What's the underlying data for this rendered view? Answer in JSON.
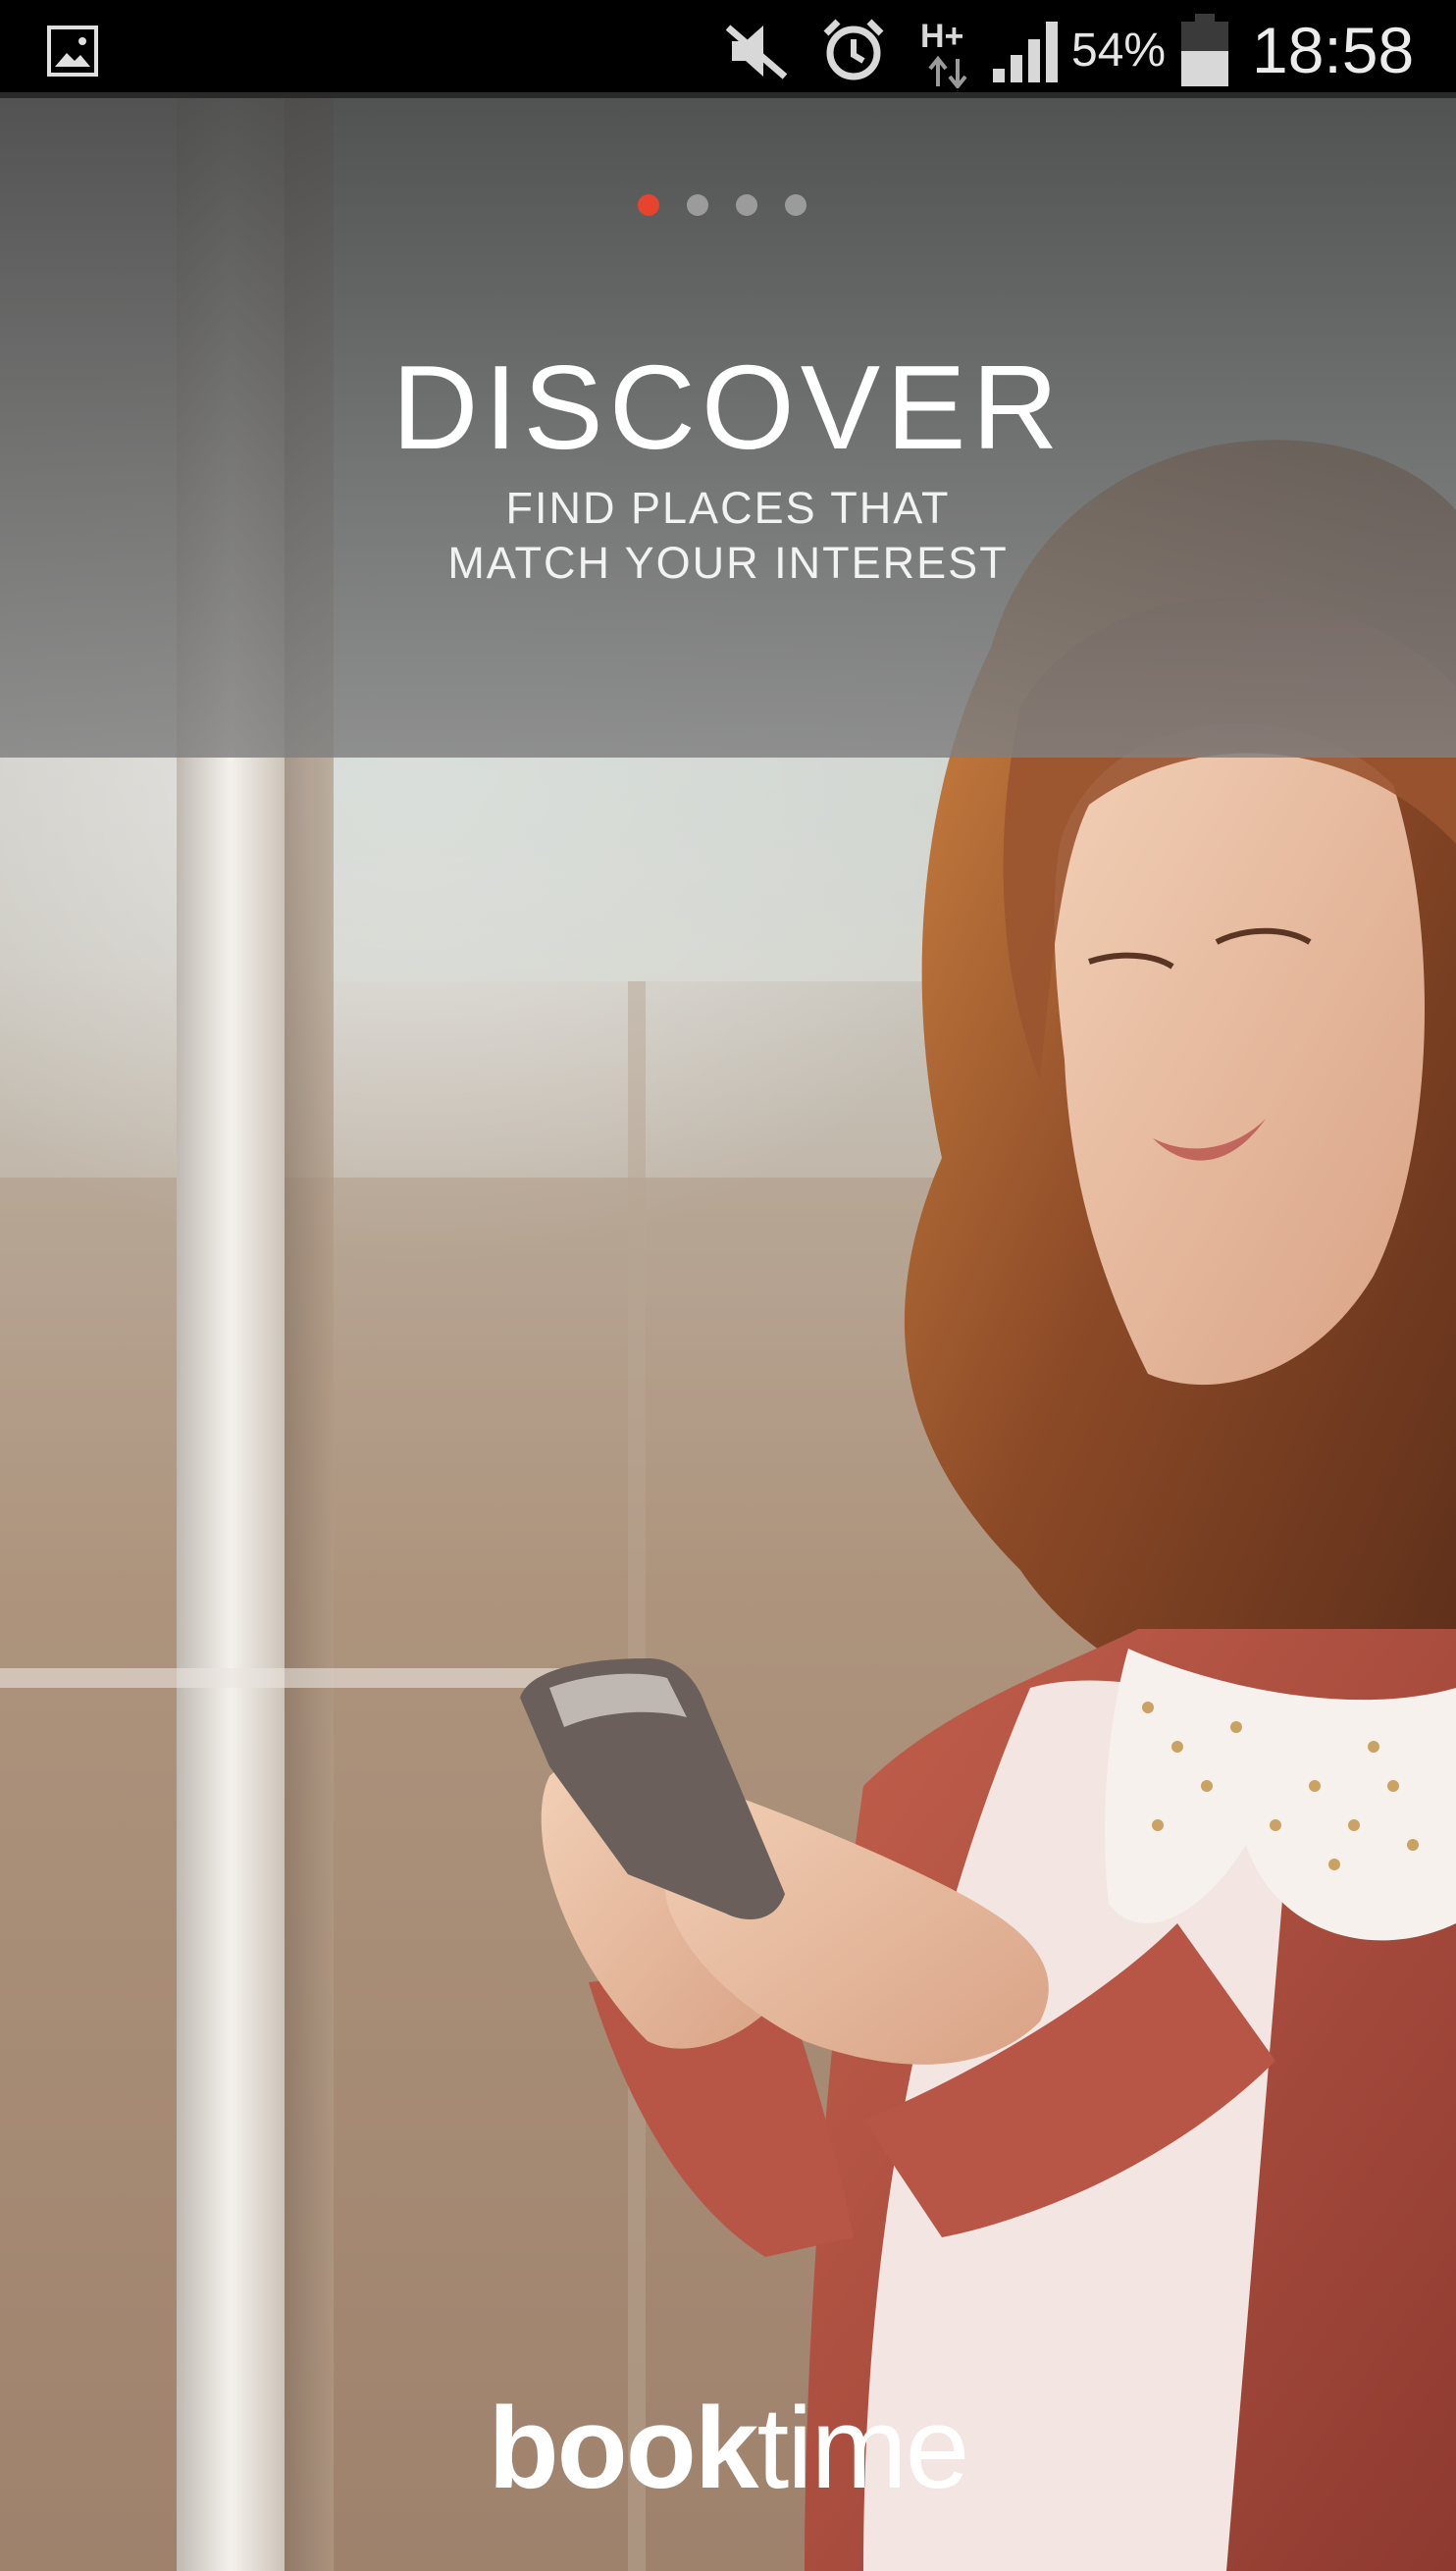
{
  "status_bar": {
    "battery_percent": "54%",
    "clock": "18:58",
    "network": "H+",
    "icons": [
      "gallery-icon",
      "mute-icon",
      "alarm-icon",
      "h-plus-icon",
      "signal-icon",
      "battery-icon"
    ]
  },
  "onboarding": {
    "pager": {
      "total_pages": 4,
      "current_page": 1,
      "active_color": "#e8432f",
      "inactive_color": "#9b9b9b"
    },
    "title": "DISCOVER",
    "subtitle_line_1": "FIND PLACES THAT",
    "subtitle_line_2": "MATCH YOUR INTEREST"
  },
  "brand": {
    "logo_bold": "book",
    "logo_regular": "time"
  }
}
